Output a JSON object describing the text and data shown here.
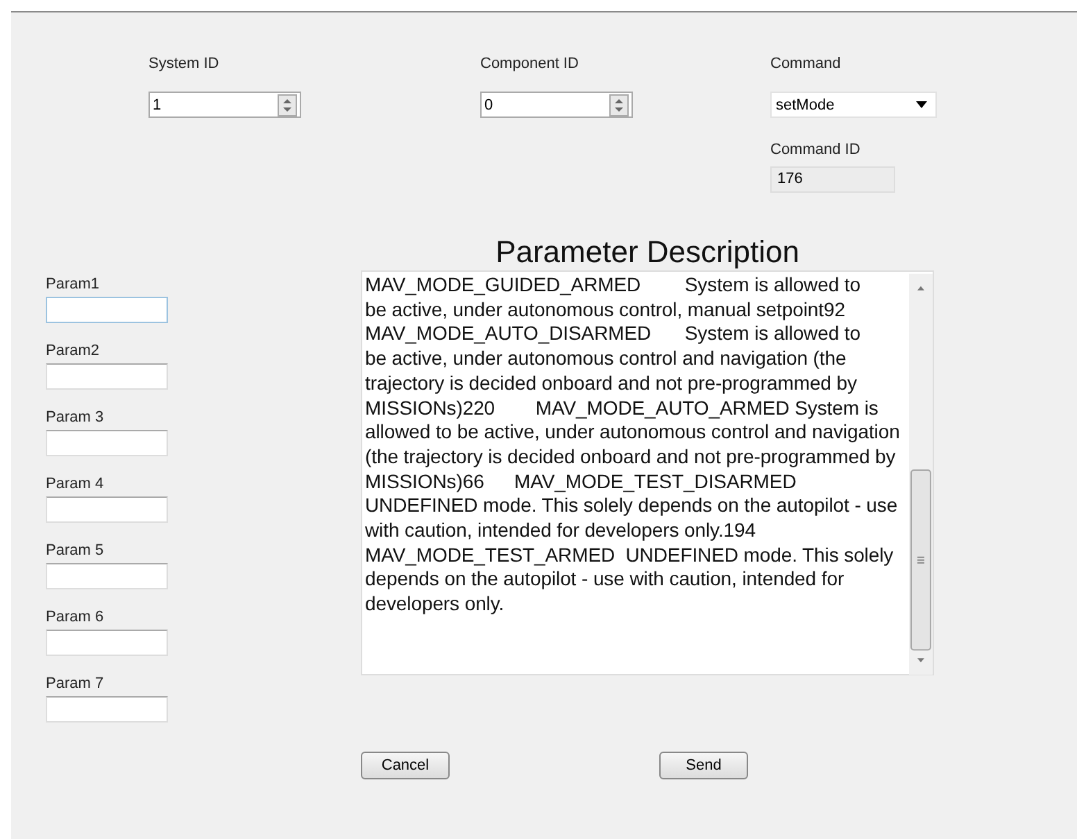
{
  "system_id": {
    "label": "System ID",
    "value": "1"
  },
  "component_id": {
    "label": "Component ID",
    "value": "0"
  },
  "command": {
    "label": "Command",
    "value": "setMode"
  },
  "command_id": {
    "label": "Command ID",
    "value": "176"
  },
  "description": {
    "title": "Parameter Description",
    "lines": [
      "MAV_MODE_GUIDED_ARMED\t\tSystem is allowed to",
      "be active, under autonomous control, manual setpoint92",
      "MAV_MODE_AUTO_DISARMED\t\tSystem is allowed to",
      "be active, under autonomous control and navigation (the",
      "trajectory is decided onboard and not pre-programmed by",
      "MISSIONs)220\t\tMAV_MODE_AUTO_ARMED System is",
      "allowed to be active, under autonomous control and navigation",
      "(the trajectory is decided onboard and not pre-programmed by",
      "MISSIONs)66\t\tMAV_MODE_TEST_DISARMED",
      "UNDEFINED mode. This solely depends on the autopilot - use",
      "with caution, intended for developers only.194",
      "MAV_MODE_TEST_ARMED  UNDEFINED mode. This solely",
      "depends on the autopilot - use with caution, intended for",
      "developers only."
    ]
  },
  "params": [
    {
      "label": "Param1"
    },
    {
      "label": "Param2"
    },
    {
      "label": "Param 3"
    },
    {
      "label": "Param 4"
    },
    {
      "label": "Param 5"
    },
    {
      "label": "Param 6"
    },
    {
      "label": "Param 7"
    }
  ],
  "buttons": [
    "Cancel",
    "Send"
  ]
}
